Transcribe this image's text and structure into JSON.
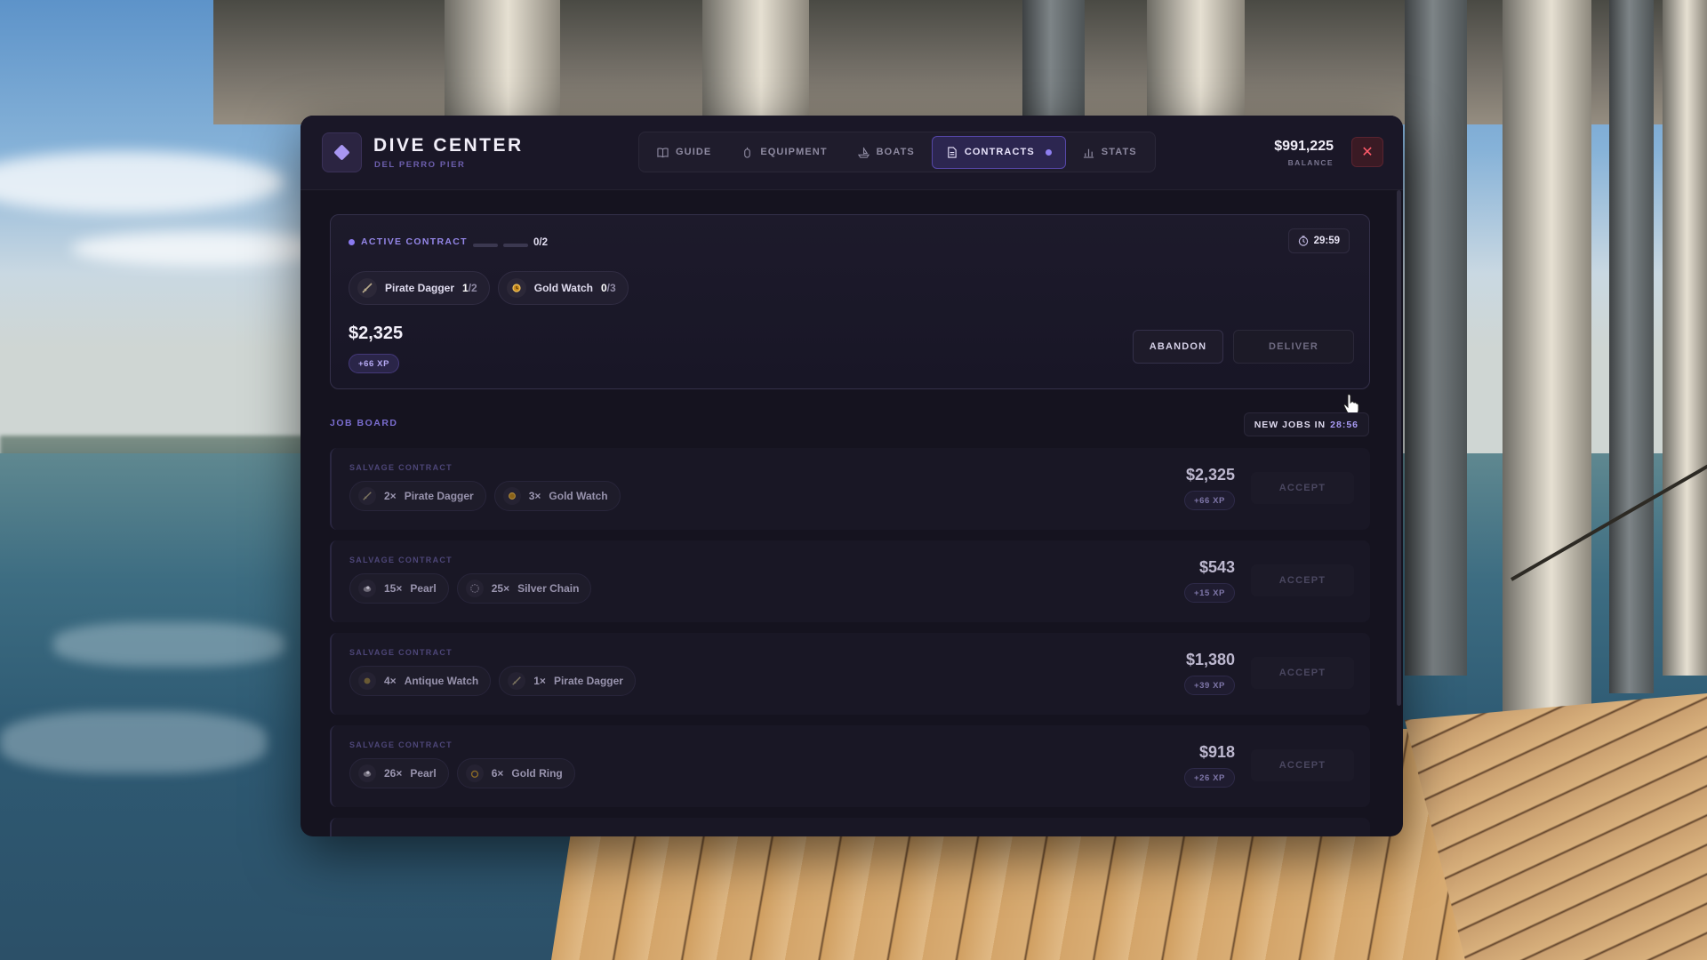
{
  "app": {
    "title": "DIVE CENTER",
    "subtitle": "DEL PERRO PIER"
  },
  "tabs": [
    {
      "label": "GUIDE",
      "icon": "book-icon",
      "active": false
    },
    {
      "label": "EQUIPMENT",
      "icon": "tank-icon",
      "active": false
    },
    {
      "label": "BOATS",
      "icon": "boat-icon",
      "active": false
    },
    {
      "label": "CONTRACTS",
      "icon": "document-icon",
      "active": true
    },
    {
      "label": "STATS",
      "icon": "bar-chart-icon",
      "active": false
    }
  ],
  "balance": {
    "amount": "$991,225",
    "label": "BALANCE"
  },
  "active_contract": {
    "label": "ACTIVE CONTRACT",
    "progress_text": "0/2",
    "progress_fraction": 0,
    "timer": "29:59",
    "requirements": [
      {
        "item": "Pirate Dagger",
        "have": "1",
        "need": "/2",
        "icon": "dagger-icon"
      },
      {
        "item": "Gold Watch",
        "have": "0",
        "need": "/3",
        "icon": "gold-watch-icon"
      }
    ],
    "reward": "$2,325",
    "xp": "+66 XP",
    "abandon_label": "ABANDON",
    "deliver_label": "DELIVER"
  },
  "job_board": {
    "title": "JOB BOARD",
    "new_jobs_label": "NEW JOBS IN",
    "new_jobs_timer": "28:56",
    "jobs": [
      {
        "label": "SALVAGE CONTRACT",
        "items": [
          {
            "qty": "2×",
            "name": "Pirate Dagger",
            "icon": "dagger-icon"
          },
          {
            "qty": "3×",
            "name": "Gold Watch",
            "icon": "gold-watch-icon"
          }
        ],
        "reward": "$2,325",
        "xp": "+66 XP",
        "accept_label": "ACCEPT"
      },
      {
        "label": "SALVAGE CONTRACT",
        "items": [
          {
            "qty": "15×",
            "name": "Pearl",
            "icon": "pearl-icon"
          },
          {
            "qty": "25×",
            "name": "Silver Chain",
            "icon": "chain-icon"
          }
        ],
        "reward": "$543",
        "xp": "+15 XP",
        "accept_label": "ACCEPT"
      },
      {
        "label": "SALVAGE CONTRACT",
        "items": [
          {
            "qty": "4×",
            "name": "Antique Watch",
            "icon": "antique-watch-icon"
          },
          {
            "qty": "1×",
            "name": "Pirate Dagger",
            "icon": "dagger-icon"
          }
        ],
        "reward": "$1,380",
        "xp": "+39 XP",
        "accept_label": "ACCEPT"
      },
      {
        "label": "SALVAGE CONTRACT",
        "items": [
          {
            "qty": "26×",
            "name": "Pearl",
            "icon": "pearl-icon"
          },
          {
            "qty": "6×",
            "name": "Gold Ring",
            "icon": "gold-ring-icon"
          }
        ],
        "reward": "$918",
        "xp": "+26 XP",
        "accept_label": "ACCEPT"
      }
    ]
  },
  "colors": {
    "accent": "#8e7ff0",
    "panel": "#15131f",
    "close": "#ff5a6a"
  }
}
